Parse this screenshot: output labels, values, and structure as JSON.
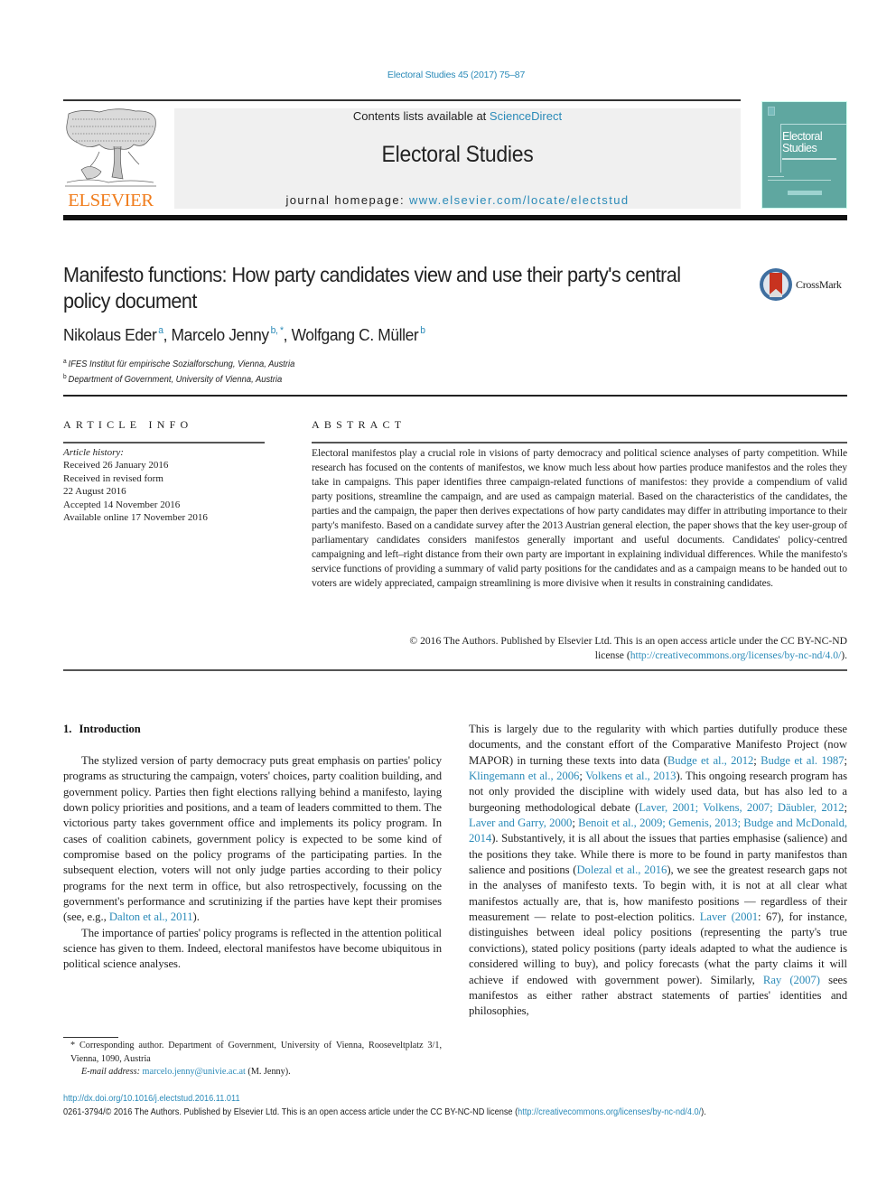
{
  "journal_ref": "Electoral Studies 45 (2017) 75–87",
  "header": {
    "publisher_logo_text": "ELSEVIER",
    "contents_prefix": "Contents lists available at ",
    "contents_link": "ScienceDirect",
    "journal_name": "Electoral Studies",
    "homepage_prefix": "journal homepage: ",
    "homepage_link": "www.elsevier.com/locate/electstud",
    "cover_title_line1": "Electoral",
    "cover_title_line2": "Studies"
  },
  "crossmark_label": "CrossMark",
  "colors": {
    "link": "#2a8ab8",
    "elsevier_orange": "#f07c1b",
    "cover_teal": "#5fa7a0",
    "header_box_gray": "#f0f0f0"
  },
  "article": {
    "title": "Manifesto functions: How party candidates view and use their party's central policy document",
    "authors": [
      {
        "name": "Nikolaus Eder",
        "sup": "a"
      },
      {
        "name": "Marcelo Jenny",
        "sup": "b, *"
      },
      {
        "name": "Wolfgang C. Müller",
        "sup": "b"
      }
    ],
    "affiliations": [
      {
        "key": "a",
        "text": "IFES Institut für empirische Sozialforschung, Vienna, Austria"
      },
      {
        "key": "b",
        "text": "Department of Government, University of Vienna, Austria"
      }
    ]
  },
  "article_info": {
    "heading": "ARTICLE INFO",
    "history_label": "Article history:",
    "history": [
      "Received 26 January 2016",
      "Received in revised form",
      "22 August 2016",
      "Accepted 14 November 2016",
      "Available online 17 November 2016"
    ]
  },
  "abstract": {
    "heading": "ABSTRACT",
    "body": "Electoral manifestos play a crucial role in visions of party democracy and political science analyses of party competition. While research has focused on the contents of manifestos, we know much less about how parties produce manifestos and the roles they take in campaigns. This paper identifies three campaign-related functions of manifestos: they provide a compendium of valid party positions, streamline the campaign, and are used as campaign material. Based on the characteristics of the candidates, the parties and the campaign, the paper then derives expectations of how party candidates may differ in attributing importance to their party's manifesto. Based on a candidate survey after the 2013 Austrian general election, the paper shows that the key user-group of parliamentary candidates considers manifestos generally important and useful documents. Candidates' policy-centred campaigning and left–right distance from their own party are important in explaining individual differences. While the manifesto's service functions of providing a summary of valid party positions for the candidates and as a campaign means to be handed out to voters are widely appreciated, campaign streamlining is more divisive when it results in constraining candidates.",
    "copyright_line1": "© 2016 The Authors. Published by Elsevier Ltd. This is an open access article under the CC BY-NC-ND",
    "copyright_line2_prefix": "license (",
    "license_link": "http://creativecommons.org/licenses/by-nc-nd/4.0/",
    "copyright_line2_suffix": ")."
  },
  "section": {
    "number": "1.",
    "title": "Introduction",
    "left_p1": "The stylized version of party democracy puts great emphasis on parties' policy programs as structuring the campaign, voters' choices, party coalition building, and government policy. Parties then fight elections rallying behind a manifesto, laying down policy priorities and positions, and a team of leaders committed to them. The victorious party takes government office and implements its policy program. In cases of coalition cabinets, government policy is expected to be some kind of compromise based on the policy programs of the participating parties. In the subsequent election, voters will not only judge parties according to their policy programs for the next term in office, but also retrospectively, focussing on the government's performance and scrutinizing if the parties have kept their promises (see, e.g., ",
    "left_p1_cite": "Dalton et al., 2011",
    "left_p1_end": ").",
    "left_p2": "The importance of parties' policy programs is reflected in the attention political science has given to them. Indeed, electoral manifestos have become ubiquitous in political science analyses.",
    "right": [
      {
        "t": "text",
        "v": "This is largely due to the regularity with which parties dutifully produce these documents, and the constant effort of the Comparative Manifesto Project (now MAPOR) in turning these texts into data ("
      },
      {
        "t": "cite",
        "v": "Budge et al., 2012"
      },
      {
        "t": "text",
        "v": "; "
      },
      {
        "t": "cite",
        "v": "Budge et al. 1987"
      },
      {
        "t": "text",
        "v": "; "
      },
      {
        "t": "cite",
        "v": "Klingemann et al., 2006"
      },
      {
        "t": "text",
        "v": "; "
      },
      {
        "t": "cite",
        "v": "Volkens et al., 2013"
      },
      {
        "t": "text",
        "v": "). This ongoing research program has not only provided the discipline with widely used data, but has also led to a burgeoning methodological debate ("
      },
      {
        "t": "cite",
        "v": "Laver, 2001; Volkens, 2007; Däubler, 2012"
      },
      {
        "t": "text",
        "v": "; "
      },
      {
        "t": "cite",
        "v": "Laver and Garry, 2000"
      },
      {
        "t": "text",
        "v": "; "
      },
      {
        "t": "cite",
        "v": "Benoit et al., 2009; Gemenis, 2013; Budge and McDonald, 2014"
      },
      {
        "t": "text",
        "v": "). Substantively, it is all about the issues that parties emphasise (salience) and the positions they take. While there is more to be found in party manifestos than salience and positions ("
      },
      {
        "t": "cite",
        "v": "Dolezal et al., 2016"
      },
      {
        "t": "text",
        "v": "), we see the greatest research gaps not in the analyses of manifesto texts. To begin with, it is not at all clear what manifestos actually are, that is, how manifesto positions — regardless of their measurement — relate to post-election politics. "
      },
      {
        "t": "cite",
        "v": "Laver (2001"
      },
      {
        "t": "text",
        "v": ": 67), for instance, distinguishes between ideal policy positions (representing the party's true convictions), stated policy positions (party ideals adapted to what the audience is considered willing to buy), and policy forecasts (what the party claims it will achieve if endowed with government power). Similarly, "
      },
      {
        "t": "cite",
        "v": "Ray (2007)"
      },
      {
        "t": "text",
        "v": " sees manifestos as either rather abstract statements of parties' identities and philosophies,"
      }
    ]
  },
  "footnote": {
    "star": "*",
    "corresponding": "Corresponding author. Department of Government, University of Vienna, Rooseveltplatz 3/1, Vienna, 1090, Austria",
    "email_label": "E-mail address:",
    "email": "marcelo.jenny@univie.ac.at",
    "email_suffix": " (M. Jenny)."
  },
  "footer": {
    "doi": "http://dx.doi.org/10.1016/j.electstud.2016.11.011",
    "issn_text": "0261-3794/© 2016 The Authors. Published by Elsevier Ltd. This is an open access article under the CC BY-NC-ND license (",
    "license_link": "http://creativecommons.org/licenses/by-nc-nd/4.0/",
    "issn_suffix": ")."
  }
}
